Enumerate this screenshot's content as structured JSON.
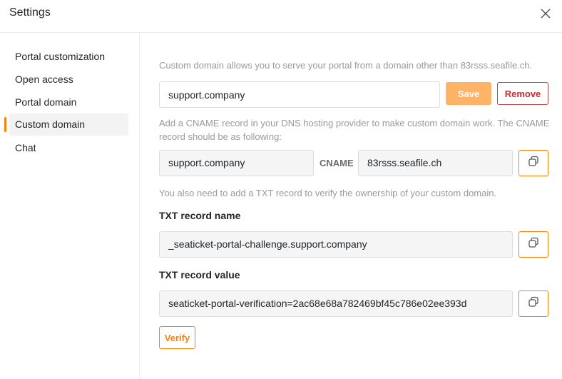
{
  "header": {
    "title": "Settings",
    "close_icon": "close-icon"
  },
  "sidebar": {
    "items": [
      {
        "label": "Portal customization",
        "active": false
      },
      {
        "label": "Open access",
        "active": false
      },
      {
        "label": "Portal domain",
        "active": false
      },
      {
        "label": "Custom domain",
        "active": true
      },
      {
        "label": "Chat",
        "active": false
      }
    ]
  },
  "main": {
    "intro": "Custom domain allows you to serve your portal from a domain other than 83rsss.seafile.ch.",
    "domain_value": "support.company",
    "save_label": "Save",
    "remove_label": "Remove",
    "cname_hint_line1": "Add a CNAME record in your DNS hosting provider to make custom domain work. The CNAME",
    "cname_hint_line2": "record should be as following:",
    "cname_host": "support.company",
    "cname_label": "CNAME",
    "cname_target": "83rsss.seafile.ch",
    "txt_hint": "You also need to add a TXT record to verify the ownership of your custom domain.",
    "txt_name_label": "TXT record name",
    "txt_name_value": "_seaticket-portal-challenge.support.company",
    "txt_value_label": "TXT record value",
    "txt_value_value": "seaticket-portal-verification=2ac68e68a782469bf45c786e02ee393d",
    "verify_label": "Verify",
    "copy_icon": "copy-icon"
  },
  "colors": {
    "accent": "#ff8000",
    "save_bg": "#ffb366",
    "remove": "#ce2a29",
    "active_bg": "#f3f3f3"
  }
}
